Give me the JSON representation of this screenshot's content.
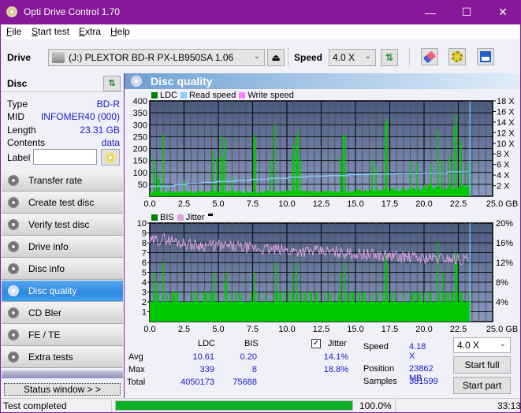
{
  "window": {
    "title": "Opti Drive Control 1.70",
    "minimize": "—",
    "maximize": "☐",
    "close": "✕"
  },
  "menu": [
    {
      "accel": "F",
      "rest": "ile"
    },
    {
      "accel": "S",
      "rest": "tart test"
    },
    {
      "accel": "E",
      "rest": "xtra"
    },
    {
      "accel": "H",
      "rest": "elp"
    }
  ],
  "menu_labels": [
    "File",
    "Start test",
    "Extra",
    "Help"
  ],
  "toolbar": {
    "drive_label": "Drive",
    "drive_value": "(J:)  PLEXTOR BD-R  PX-LB950SA 1.06",
    "speed_label": "Speed",
    "speed_value": "4.0 X",
    "eject_icon": "⏏",
    "refresh_icon": "⇅",
    "erase_icon": "eraser",
    "settings_icon": "gears",
    "save_icon": "floppy"
  },
  "disc": {
    "header": "Disc",
    "type_label": "Type",
    "type_value": "BD-R",
    "mid_label": "MID",
    "mid_value": "INFOMER40 (000)",
    "length_label": "Length",
    "length_value": "23.31 GB",
    "contents_label": "Contents",
    "contents_value": "data",
    "label_label": "Label",
    "label_value": ""
  },
  "nav": [
    {
      "label": "Transfer rate",
      "active": false
    },
    {
      "label": "Create test disc",
      "active": false
    },
    {
      "label": "Verify test disc",
      "active": false
    },
    {
      "label": "Drive info",
      "active": false
    },
    {
      "label": "Disc info",
      "active": false
    },
    {
      "label": "Disc quality",
      "active": true
    },
    {
      "label": "CD Bler",
      "active": false
    },
    {
      "label": "FE / TE",
      "active": false
    },
    {
      "label": "Extra tests",
      "active": false
    }
  ],
  "status_window_button": "Status window > >",
  "panel_title": "Disc quality",
  "chart_data": [
    {
      "type": "bar",
      "title": "LDC / Read speed",
      "legend": [
        {
          "name": "LDC",
          "color": "#008000"
        },
        {
          "name": "Read speed",
          "color": "#87cefa"
        },
        {
          "name": "Write speed",
          "color": "#ff80ff"
        }
      ],
      "xlim": [
        0,
        25
      ],
      "x_ticks": [
        "0.0",
        "2.5",
        "5.0",
        "7.5",
        "10.0",
        "12.5",
        "15.0",
        "17.5",
        "20.0",
        "22.5",
        "25.0 GB"
      ],
      "ylim_left": [
        0,
        400
      ],
      "y_ticks_left": [
        "50",
        "100",
        "150",
        "200",
        "250",
        "300",
        "350",
        "400"
      ],
      "ylim_right": [
        0,
        18
      ],
      "y_ticks_right": [
        "2 X",
        "4 X",
        "6 X",
        "8 X",
        "10 X",
        "12 X",
        "14 X",
        "16 X",
        "18 X"
      ],
      "data_end_gb": 23.31,
      "ldc_baseline": [
        [
          0,
          18
        ],
        [
          5,
          20
        ],
        [
          10,
          20
        ],
        [
          15,
          22
        ],
        [
          18,
          28
        ],
        [
          20,
          38
        ],
        [
          22.5,
          42
        ],
        [
          23.3,
          40
        ]
      ],
      "ldc_spikes": [
        [
          0.3,
          160
        ],
        [
          0.35,
          118
        ],
        [
          0.6,
          90
        ],
        [
          0.7,
          70
        ],
        [
          1.0,
          260
        ],
        [
          2.5,
          65
        ],
        [
          4.6,
          195
        ],
        [
          4.9,
          162
        ],
        [
          5.2,
          255
        ],
        [
          5.35,
          165
        ],
        [
          5.5,
          245
        ],
        [
          6.0,
          80
        ],
        [
          7.6,
          263
        ],
        [
          7.7,
          245
        ],
        [
          8.8,
          150
        ],
        [
          9.1,
          305
        ],
        [
          10.4,
          180
        ],
        [
          10.5,
          215
        ],
        [
          10.7,
          245
        ],
        [
          10.8,
          275
        ],
        [
          11.0,
          155
        ],
        [
          13.9,
          165
        ],
        [
          14.1,
          260
        ],
        [
          14.25,
          255
        ],
        [
          16.2,
          150
        ],
        [
          16.5,
          125
        ],
        [
          17.2,
          310
        ],
        [
          17.3,
          325
        ],
        [
          19.0,
          145
        ],
        [
          19.5,
          140
        ],
        [
          20.5,
          135
        ],
        [
          21.0,
          275
        ],
        [
          21.3,
          150
        ],
        [
          21.8,
          165
        ],
        [
          22.2,
          300
        ],
        [
          22.35,
          345
        ],
        [
          22.7,
          235
        ],
        [
          23.2,
          140
        ]
      ],
      "read_speed_steps": [
        [
          0,
          1.9
        ],
        [
          1.8,
          2.2
        ],
        [
          2.7,
          2.4
        ],
        [
          3.8,
          2.6
        ],
        [
          4.9,
          2.8
        ],
        [
          6.2,
          3.0
        ],
        [
          7.3,
          3.2
        ],
        [
          8.7,
          3.4
        ],
        [
          10.1,
          3.6
        ],
        [
          11.5,
          3.8
        ],
        [
          13.0,
          3.9
        ],
        [
          14.5,
          4.1
        ],
        [
          16.0,
          4.2
        ],
        [
          18.0,
          4.35
        ],
        [
          20.0,
          4.4
        ],
        [
          21.7,
          4.6
        ],
        [
          23.3,
          4.6
        ]
      ],
      "read_speed_end_marker": 23.35
    },
    {
      "type": "bar",
      "title": "BIS / Jitter",
      "legend": [
        {
          "name": "BIS",
          "color": "#008000"
        },
        {
          "name": "Jitter",
          "color": "#dda0dd"
        }
      ],
      "xlim": [
        0,
        25
      ],
      "x_ticks": [
        "0.0",
        "2.5",
        "5.0",
        "7.5",
        "10.0",
        "12.5",
        "15.0",
        "17.5",
        "20.0",
        "22.5",
        "25.0 GB"
      ],
      "ylim_left": [
        0,
        10
      ],
      "y_ticks_left": [
        "1",
        "2",
        "3",
        "4",
        "5",
        "6",
        "7",
        "8",
        "9",
        "10"
      ],
      "ylim_right": [
        0,
        20
      ],
      "y_ticks_right": [
        "4%",
        "8%",
        "12%",
        "16%",
        "20%"
      ],
      "data_end_gb": 23.31,
      "bis_base": 2,
      "bis_spikes": [
        [
          0.3,
          5
        ],
        [
          0.5,
          4
        ],
        [
          1.0,
          6
        ],
        [
          4.7,
          5
        ],
        [
          5.5,
          4
        ],
        [
          5.6,
          5
        ],
        [
          7.6,
          5
        ],
        [
          9.2,
          6
        ],
        [
          10.4,
          5
        ],
        [
          10.7,
          6
        ],
        [
          13.9,
          5
        ],
        [
          14.2,
          6
        ],
        [
          17.2,
          7
        ],
        [
          17.3,
          6
        ],
        [
          21.0,
          8
        ],
        [
          21.4,
          5
        ],
        [
          22.3,
          7
        ],
        [
          22.4,
          6
        ]
      ],
      "jitter_trend": [
        [
          0,
          16.2
        ],
        [
          1,
          16.8
        ],
        [
          3,
          15.6
        ],
        [
          5,
          15.4
        ],
        [
          8,
          14.8
        ],
        [
          10,
          14.4
        ],
        [
          13,
          14.2
        ],
        [
          16,
          13.6
        ],
        [
          19,
          13.0
        ],
        [
          22,
          12.8
        ],
        [
          23.3,
          12.6
        ]
      ]
    }
  ],
  "stats": {
    "col_ldc": "LDC",
    "col_bis": "BIS",
    "jitter_label": "Jitter",
    "jitter_checked": "✓",
    "avg_label": "Avg",
    "avg_ldc": "10.61",
    "avg_bis": "0.20",
    "avg_jitter": "14.1%",
    "max_label": "Max",
    "max_ldc": "339",
    "max_bis": "8",
    "max_jitter": "18.8%",
    "total_label": "Total",
    "total_ldc": "4050173",
    "total_bis": "75688",
    "speed_label": "Speed",
    "speed_value": "4.18 X",
    "position_label": "Position",
    "position_value": "23862 MB",
    "samples_label": "Samples",
    "samples_value": "381599",
    "speed_select": "4.0 X",
    "start_full": "Start full",
    "start_part": "Start part"
  },
  "statusbar": {
    "text": "Test completed",
    "progress_percent": 100,
    "progress_label": "100.0%",
    "time": "33:13"
  }
}
